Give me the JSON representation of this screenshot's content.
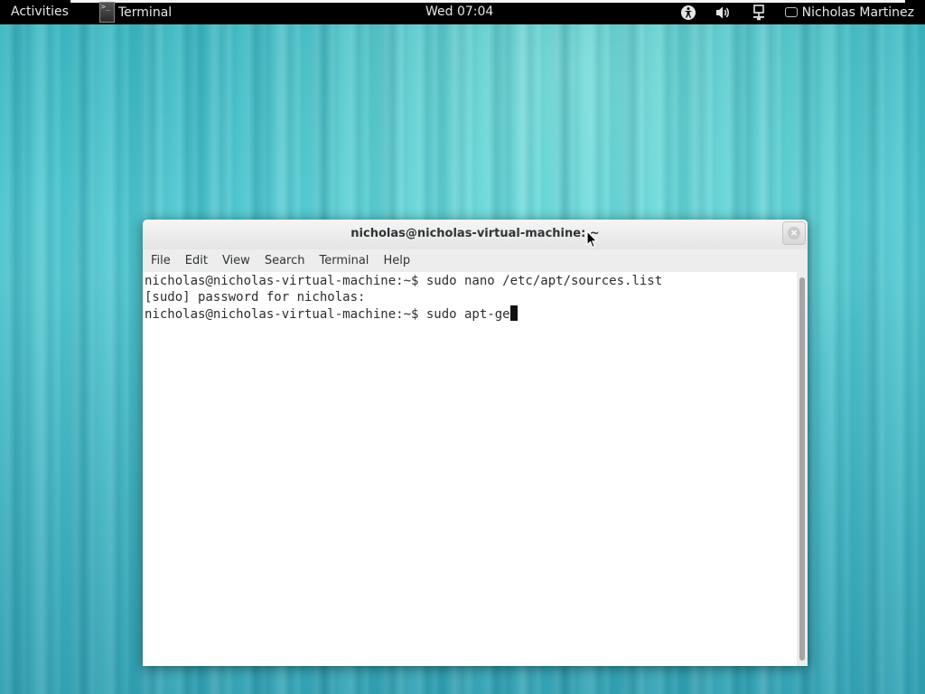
{
  "top_bar": {
    "activities": "Activities",
    "app_menu_label": "Terminal",
    "clock": "Wed 07:04",
    "user_name": "Nicholas Martinez",
    "tray_icons": [
      "accessibility-icon",
      "volume-icon",
      "network-icon"
    ]
  },
  "terminal_window": {
    "title": "nicholas@nicholas-virtual-machine: ~",
    "close_glyph": "×",
    "menu": [
      "File",
      "Edit",
      "View",
      "Search",
      "Terminal",
      "Help"
    ],
    "lines": [
      "nicholas@nicholas-virtual-machine:~$ sudo nano /etc/apt/sources.list",
      "[sudo] password for nicholas:",
      "nicholas@nicholas-virtual-machine:~$ sudo apt-ge"
    ]
  },
  "colors": {
    "top_bar_bg": "#000000",
    "desktop_accent": "#45c3cc",
    "window_bg": "#ededed",
    "terminal_bg": "#ffffff"
  }
}
